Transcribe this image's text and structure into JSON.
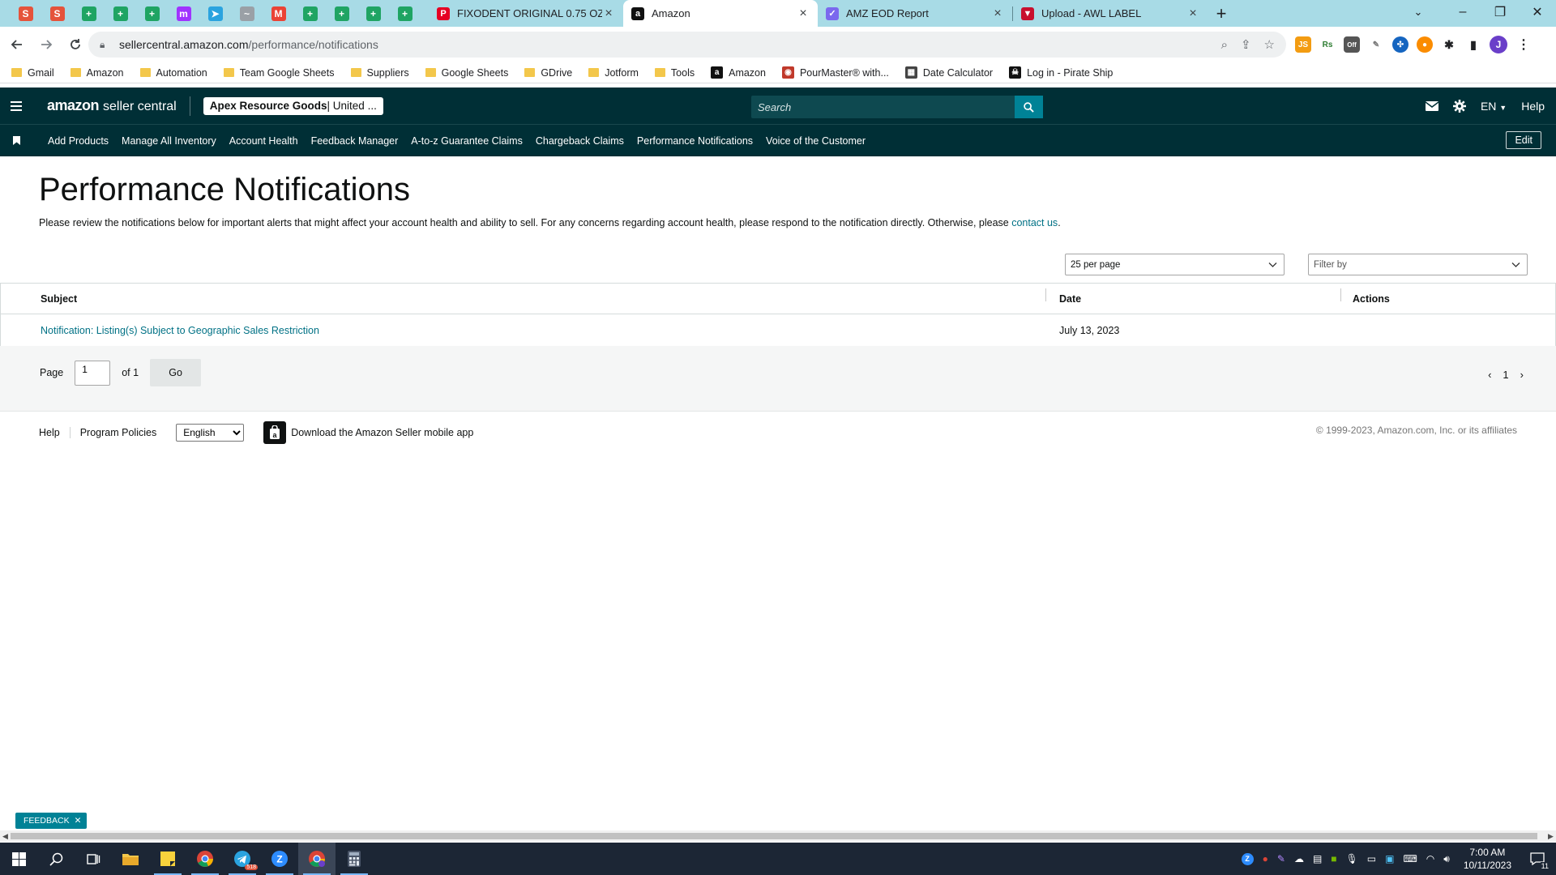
{
  "browser": {
    "pinned_tabs": [
      {
        "icon": "scribd-icon",
        "color": "#e5533b",
        "glyph": "S"
      },
      {
        "icon": "scribd-icon",
        "color": "#e5533b",
        "glyph": "S"
      },
      {
        "icon": "google-sheets-icon",
        "color": "#1fa463",
        "glyph": "+"
      },
      {
        "icon": "google-sheets-icon",
        "color": "#1fa463",
        "glyph": "+"
      },
      {
        "icon": "google-sheets-icon",
        "color": "#1fa463",
        "glyph": "+"
      },
      {
        "icon": "messenger-icon",
        "color": "#a033ff",
        "glyph": "m"
      },
      {
        "icon": "telegram-icon",
        "color": "#2aa3df",
        "glyph": "➤"
      },
      {
        "icon": "misc-icon",
        "color": "#9aa0a6",
        "glyph": "~"
      },
      {
        "icon": "gmail-icon",
        "color": "#ea4335",
        "glyph": "M"
      },
      {
        "icon": "google-sheets-icon",
        "color": "#1fa463",
        "glyph": "+"
      },
      {
        "icon": "google-sheets-icon",
        "color": "#1fa463",
        "glyph": "+"
      },
      {
        "icon": "google-sheets-icon",
        "color": "#1fa463",
        "glyph": "+"
      },
      {
        "icon": "google-sheets-icon",
        "color": "#1fa463",
        "glyph": "+"
      }
    ],
    "tabs": [
      {
        "title": "FIXODENT ORIGINAL 0.75 OZ - ",
        "icon": "pinterest-icon",
        "color": "#e60023",
        "glyph": "P",
        "active": false
      },
      {
        "title": "Amazon",
        "icon": "amazon-icon",
        "color": "#111111",
        "glyph": "a",
        "active": true
      },
      {
        "title": "AMZ EOD Report",
        "icon": "clickup-icon",
        "color": "#7b68ee",
        "glyph": "✓",
        "active": false
      },
      {
        "title": "Upload - AWL LABEL",
        "icon": "awl-icon",
        "color": "#c8102e",
        "glyph": "▼",
        "active": false
      }
    ],
    "url_host": "sellercentral.amazon.com",
    "url_path": "/performance/notifications",
    "profile_initial": "J",
    "bookmarks": [
      {
        "label": "Gmail",
        "type": "folder"
      },
      {
        "label": "Amazon",
        "type": "folder"
      },
      {
        "label": "Automation",
        "type": "folder"
      },
      {
        "label": "Team Google Sheets",
        "type": "folder"
      },
      {
        "label": "Suppliers",
        "type": "folder"
      },
      {
        "label": "Google Sheets",
        "type": "folder"
      },
      {
        "label": "GDrive",
        "type": "folder"
      },
      {
        "label": "Jotform",
        "type": "folder"
      },
      {
        "label": "Tools",
        "type": "folder"
      },
      {
        "label": "Amazon",
        "type": "amazon"
      },
      {
        "label": "PourMaster® with...",
        "type": "pourmaster"
      },
      {
        "label": "Date Calculator",
        "type": "calculator"
      },
      {
        "label": "Log in - Pirate Ship",
        "type": "pirateship"
      }
    ]
  },
  "header": {
    "logo_amazon": "amazon",
    "logo_sc": "seller central",
    "store_bold": "Apex Resource Goods",
    "store_rest": " | United ...",
    "search_placeholder": "Search",
    "language": "EN",
    "help": "Help"
  },
  "nav": {
    "links": [
      "Add Products",
      "Manage All Inventory",
      "Account Health",
      "Feedback Manager",
      "A-to-z Guarantee Claims",
      "Chargeback Claims",
      "Performance Notifications",
      "Voice of the Customer"
    ],
    "edit": "Edit"
  },
  "main": {
    "title": "Performance Notifications",
    "description": "Please review the notifications below for important alerts that might affect your account health and ability to sell. For any concerns regarding account health, please respond to the notification directly. Otherwise, please ",
    "contact_link": "contact us",
    "description_end": ".",
    "per_page": "25 per page",
    "filter_placeholder": "Filter by",
    "columns": {
      "subject": "Subject",
      "date": "Date",
      "actions": "Actions"
    },
    "rows": [
      {
        "subject": "Notification: Listing(s) Subject to Geographic Sales Restriction",
        "date": "July 13, 2023",
        "actions": ""
      }
    ],
    "pager": {
      "page_label": "Page",
      "page_value": "1",
      "of_label": "of 1",
      "go": "Go",
      "current": "1"
    }
  },
  "footer": {
    "help": "Help",
    "policies": "Program Policies",
    "language": "English",
    "app_text": "Download the Amazon Seller mobile app",
    "copyright": "© 1999-2023, Amazon.com, Inc. or its affiliates"
  },
  "feedback": "FEEDBACK",
  "taskbar": {
    "time": "7:00 AM",
    "date": "10/11/2023",
    "notifications": "11",
    "telegram_badge": "518"
  },
  "colors": {
    "nav_bg": "#002f36",
    "accent": "#008296",
    "link": "#007185"
  }
}
